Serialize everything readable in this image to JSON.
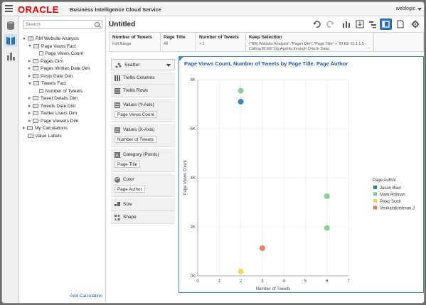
{
  "header": {
    "brand": "ORACLE",
    "service": "Business Intelligence Cloud Service",
    "user": "weblogic"
  },
  "datapanel": {
    "search_placeholder": "Search",
    "tree": [
      {
        "label": "RM Website Analysis",
        "state": "open",
        "level": 0,
        "icon": "database"
      },
      {
        "label": "Page Views Fact",
        "state": "open",
        "level": 1,
        "icon": "folder"
      },
      {
        "label": "Page Views Count",
        "state": "none",
        "level": 2,
        "icon": "measure"
      },
      {
        "label": "Pages Dim",
        "state": "closed",
        "level": 1,
        "icon": "folder"
      },
      {
        "label": "Pages Written Date Dim",
        "state": "closed",
        "level": 1,
        "icon": "folder"
      },
      {
        "label": "Posts Date Dim",
        "state": "closed",
        "level": 1,
        "icon": "folder"
      },
      {
        "label": "Tweets Fact",
        "state": "open",
        "level": 1,
        "icon": "folder"
      },
      {
        "label": "Number of Tweets",
        "state": "none",
        "level": 2,
        "icon": "measure"
      },
      {
        "label": "Tweet Details Dim",
        "state": "closed",
        "level": 1,
        "icon": "folder"
      },
      {
        "label": "Tweets Date Dim",
        "state": "closed",
        "level": 1,
        "icon": "folder"
      },
      {
        "label": "Twitter Users Dim",
        "state": "closed",
        "level": 1,
        "icon": "folder"
      },
      {
        "label": "Page Viewers Dim",
        "state": "closed",
        "level": 1,
        "icon": "folder"
      },
      {
        "label": "My Calculations",
        "state": "closed",
        "level": 0,
        "icon": "folder"
      },
      {
        "label": "Value Labels",
        "state": "none",
        "level": 0,
        "icon": "tag"
      }
    ],
    "add_calculation": "Add Calculation"
  },
  "canvas": {
    "title": "Untitled"
  },
  "filters": [
    {
      "header": "Number of Tweets",
      "value": "Full Range"
    },
    {
      "header": "Page Title",
      "value": "All"
    },
    {
      "header": "Number of Tweets",
      "value": "> 1"
    },
    {
      "header": "Keep Selection",
      "value": "(\"RM Website Analysis\".\"Pages Dim\".\"Page Title\" + 'BI EE 11.1.1.5 - Calling BI EE 11g Agents through Oracle Data"
    }
  ],
  "grammar": {
    "chart_type": "Scatter",
    "trellis_columns": "Trellis Columns",
    "trellis_rows": "Trellis Rows",
    "values_y_label": "Values (Y-Axis)",
    "values_y_item": "Page Views Count",
    "values_x_label": "Values (X-Axis)",
    "values_x_item": "Number of Tweets",
    "category_label": "Category (Points)",
    "category_item": "Page Title",
    "color_label": "Color",
    "color_item": "Page Author",
    "size_label": "Size",
    "shape_label": "Shape"
  },
  "colors": {
    "accent": "#4d85c7",
    "title_blue": "#1f5aa6",
    "brand_red": "#e00000"
  },
  "chart_data": {
    "type": "scatter",
    "title": "Page Views Count, Number of Tweets by Page Title, Page Author",
    "xlabel": "Number of Tweets",
    "ylabel": "Page Views Count",
    "xlim": [
      0,
      7
    ],
    "ylim": [
      0,
      8000
    ],
    "x_ticks": [
      "0",
      "1",
      "2",
      "3",
      "4",
      "5",
      "6",
      "7"
    ],
    "y_ticks": [
      "0K",
      "2K",
      "4K",
      "6K",
      "8K"
    ],
    "grid": true,
    "legend_title": "Page Author",
    "legend_position": "right",
    "series": [
      {
        "name": "Jason Baer",
        "color": "#2f77b6",
        "points": [
          {
            "x": 2,
            "y": 7100
          }
        ]
      },
      {
        "name": "Mark Rittman",
        "color": "#7fca8c",
        "points": [
          {
            "x": 2,
            "y": 7550
          },
          {
            "x": 6,
            "y": 3250
          },
          {
            "x": 6,
            "y": 1950
          }
        ]
      },
      {
        "name": "Peter Scott",
        "color": "#f7d45c",
        "points": [
          {
            "x": 2,
            "y": 180
          }
        ]
      },
      {
        "name": "Venkatakrishnan J",
        "color": "#e8755a",
        "points": [
          {
            "x": 3,
            "y": 1130
          }
        ]
      }
    ]
  }
}
